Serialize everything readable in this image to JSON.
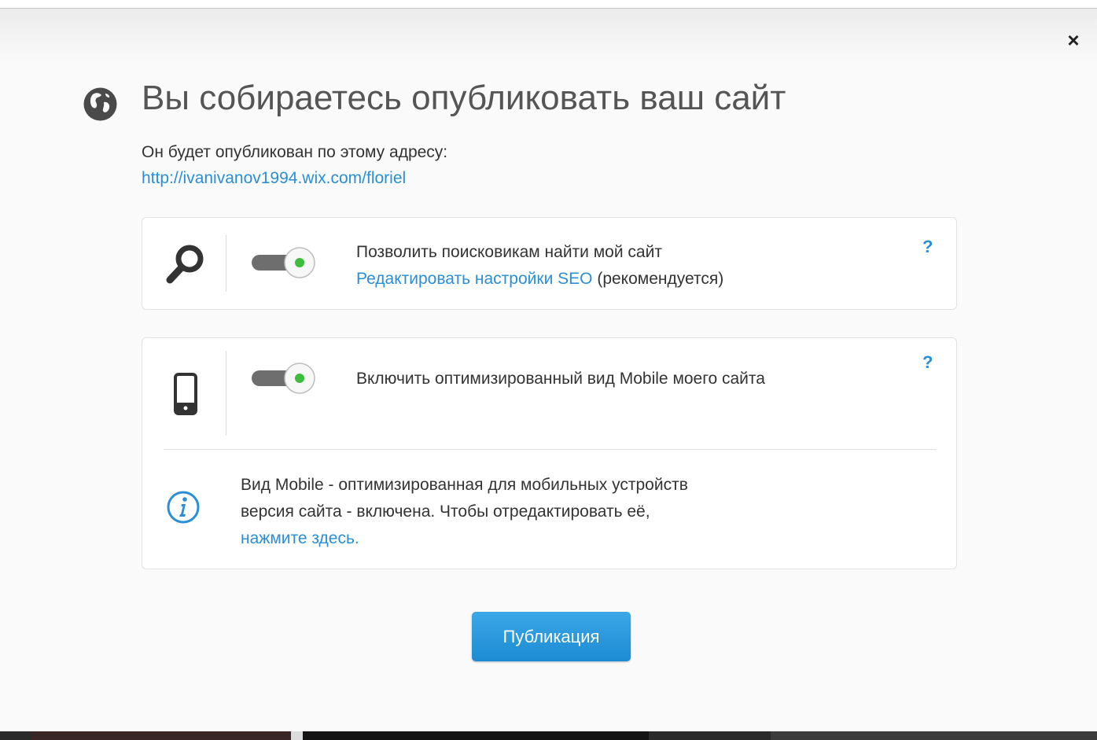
{
  "dialog": {
    "close_glyph": "×",
    "title": "Вы собираетесь опубликовать ваш сайт",
    "subtitle": "Он будет опубликован по этому адресу:",
    "url": "http://ivanivanov1994.wix.com/floriel"
  },
  "seo": {
    "icon": "search-icon",
    "toggle_on": true,
    "label": "Позволить поисковикам найти мой сайт",
    "edit_link": "Редактировать настройки SEO",
    "recommended": "(рекомендуется)",
    "help": "?"
  },
  "mobile": {
    "icon": "mobile-phone-icon",
    "toggle_on": true,
    "label": "Включить оптимизированный вид Mobile моего сайта",
    "help": "?",
    "info_line1": "Вид Mobile - оптимизированная для мобильных устройств",
    "info_line2": "версия сайта - включена. Чтобы отредактировать её,",
    "info_link": "нажмите здесь."
  },
  "footer": {
    "publish_label": "Публикация"
  },
  "colors": {
    "accent": "#2a8fd6",
    "toggle_on_dot": "#3dbd3d",
    "button": "#1d8bd3"
  }
}
